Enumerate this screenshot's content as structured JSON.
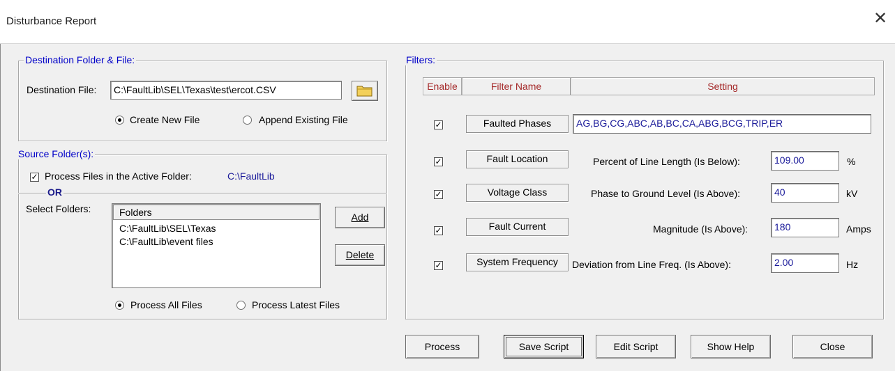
{
  "window": {
    "title": "Disturbance Report",
    "close_glyph": "✕"
  },
  "destination": {
    "group_label": "Destination Folder & File:",
    "file_label": "Destination File:",
    "file_value": "C:\\FaultLib\\SEL\\Texas\\test\\ercot.CSV",
    "browse_icon": "folder-icon",
    "create_new_label": "Create New File",
    "append_label": "Append Existing File",
    "mode_selected": "create"
  },
  "source": {
    "group_label": "Source Folder(s):",
    "process_active_label": "Process Files in the Active Folder:",
    "active_folder": "C:\\FaultLib",
    "process_active_checked": true,
    "or_label": "OR",
    "select_folders_label": "Select Folders:",
    "folders_header": "Folders",
    "folders": [
      "C:\\FaultLib\\SEL\\Texas",
      "C:\\FaultLib\\event files"
    ],
    "add_label": "Add",
    "delete_label": "Delete",
    "process_all_label": "Process All Files",
    "process_latest_label": "Process Latest Files",
    "process_selected": "all"
  },
  "filters": {
    "group_label": "Filters:",
    "headers": {
      "enable": "Enable",
      "name": "Filter Name",
      "setting": "Setting"
    },
    "rows": [
      {
        "enabled": true,
        "name": "Faulted Phases",
        "setting_label": "",
        "value": "AG,BG,CG,ABC,AB,BC,CA,ABG,BCG,TRIP,ER",
        "unit": ""
      },
      {
        "enabled": true,
        "name": "Fault Location",
        "setting_label": "Percent of Line Length (Is Below):",
        "value": "109.00",
        "unit": "%"
      },
      {
        "enabled": true,
        "name": "Voltage Class",
        "setting_label": "Phase to Ground Level (Is Above):",
        "value": "40",
        "unit": "kV"
      },
      {
        "enabled": true,
        "name": "Fault Current",
        "setting_label": "Magnitude (Is Above):",
        "value": "180",
        "unit": "Amps"
      },
      {
        "enabled": true,
        "name": "System Frequency",
        "setting_label": "Deviation from Line Freq. (Is Above):",
        "value": "2.00",
        "unit": "Hz"
      }
    ]
  },
  "buttons": {
    "process": "Process",
    "save_script": "Save Script",
    "edit_script": "Edit Script",
    "show_help": "Show Help",
    "close": "Close"
  },
  "colors": {
    "legend": "#0000c8",
    "header_text": "#a52a2a",
    "folder_path": "#1a1a9a"
  }
}
